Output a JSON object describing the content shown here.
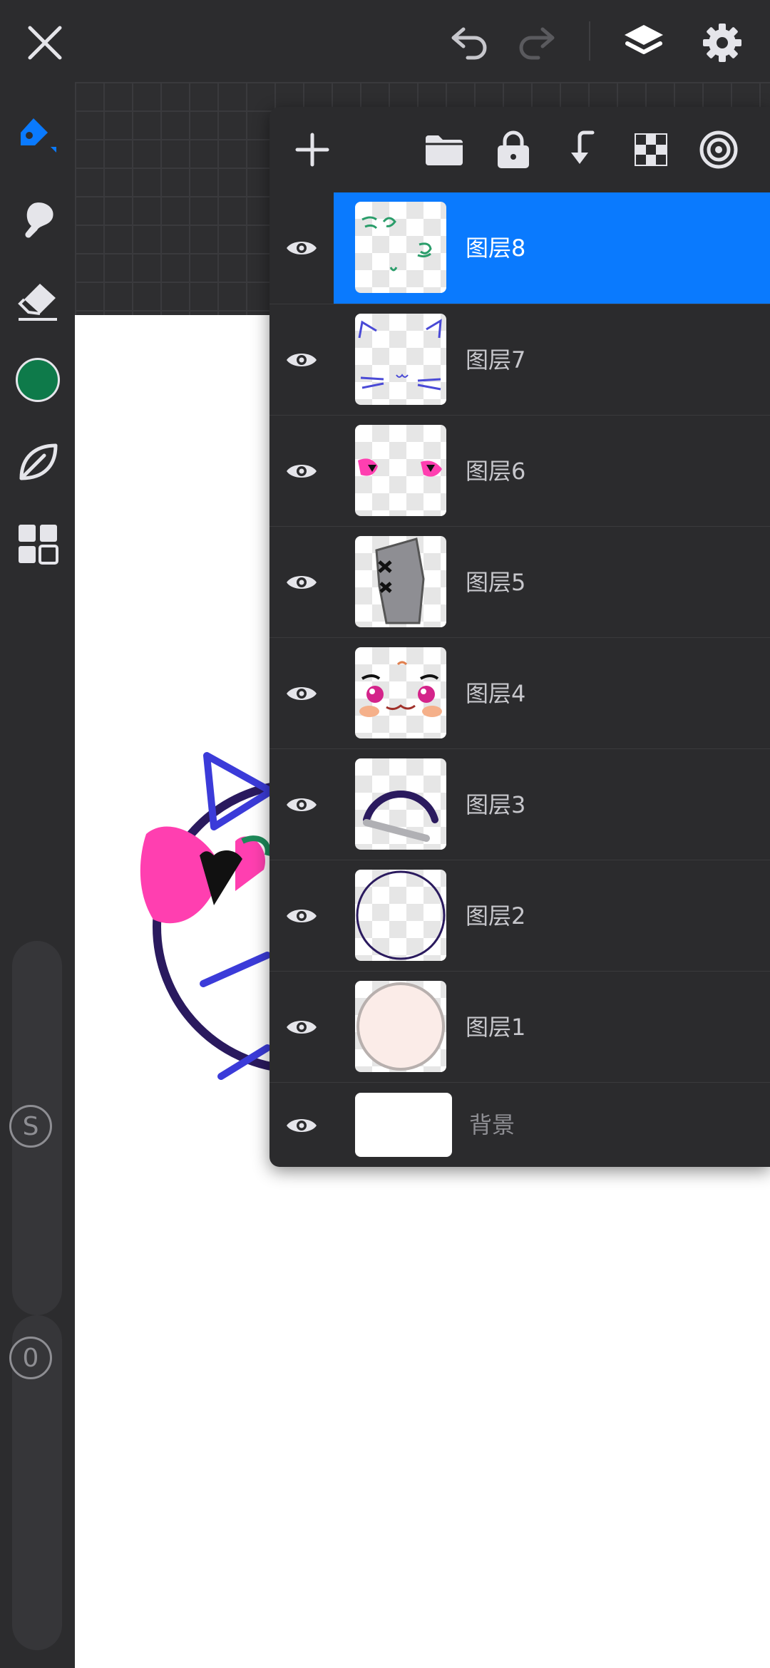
{
  "toolbar": {
    "icons": [
      "close-icon",
      "undo-icon",
      "redo-icon",
      "layers-icon",
      "settings-icon"
    ]
  },
  "sidebar": {
    "tools": [
      "brush-icon",
      "smudge-icon",
      "eraser-icon",
      "color-swatch",
      "leaf-icon",
      "gallery-icon"
    ],
    "current_color": "#0e7a4a",
    "accent_color": "#0a7afe",
    "size_label": "S",
    "opacity_label": "0"
  },
  "layers_panel": {
    "toolbar_icons": [
      "add-icon",
      "folder-icon",
      "lock-icon",
      "merge-down-icon",
      "checker-icon",
      "target-icon"
    ],
    "selected_color": "#0a7afe",
    "layers": [
      {
        "name": "图层8",
        "visible": true,
        "selected": true
      },
      {
        "name": "图层7",
        "visible": true,
        "selected": false
      },
      {
        "name": "图层6",
        "visible": true,
        "selected": false
      },
      {
        "name": "图层5",
        "visible": true,
        "selected": false
      },
      {
        "name": "图层4",
        "visible": true,
        "selected": false
      },
      {
        "name": "图层3",
        "visible": true,
        "selected": false
      },
      {
        "name": "图层2",
        "visible": true,
        "selected": false
      },
      {
        "name": "图层1",
        "visible": true,
        "selected": false
      }
    ],
    "background": {
      "name": "背景",
      "visible": true
    }
  }
}
